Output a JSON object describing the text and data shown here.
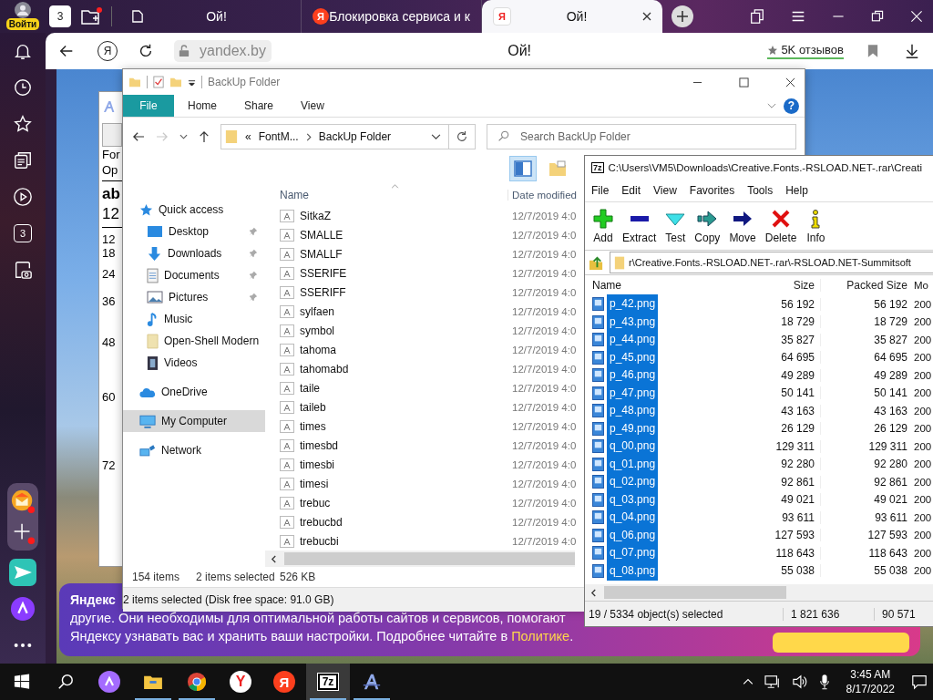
{
  "browser": {
    "account": {
      "label": "Войти"
    },
    "tab_counter": "3",
    "new_collection_badge": true,
    "tabs": [
      {
        "title": "Ой!",
        "kind": "page",
        "selected": false
      },
      {
        "title": "Блокировка сервиса и к",
        "kind": "red",
        "glyph": "Я",
        "selected": false
      },
      {
        "title": "Ой!",
        "kind": "light",
        "glyph": "Я",
        "selected": true
      }
    ],
    "address": {
      "logo": "Я",
      "url": "yandex.by",
      "page_title": "Ой!",
      "reviews": "5K отзывов"
    },
    "sidebar": [
      {
        "kind": "bell"
      },
      {
        "kind": "clock"
      },
      {
        "kind": "star"
      },
      {
        "kind": "collections"
      },
      {
        "kind": "play"
      },
      {
        "kind": "counter",
        "label": "3"
      },
      {
        "kind": "screenshot"
      }
    ],
    "apps": [
      {
        "kind": "mail",
        "badge": true
      },
      {
        "kind": "add",
        "badge": true
      },
      {
        "kind": "send",
        "badge": false
      },
      {
        "kind": "alice",
        "badge": false
      },
      {
        "kind": "more",
        "badge": false
      }
    ],
    "cookie_banner": {
      "title": "Яндекс",
      "line": "другие. Они необходимы для оптимальной работы сайтов и сервисов, помогают",
      "text": "Яндексу узнавать вас и хранить ваши настройки. Подробнее читайте в ",
      "link": "Политике",
      "end": "."
    }
  },
  "font_window": {
    "lines": [
      "For",
      "Op"
    ],
    "sample": "ab",
    "sample_size": "12",
    "sizes": [
      "12",
      "18",
      "24",
      "36",
      "48",
      "60",
      "72"
    ]
  },
  "explorer": {
    "title": "BackUp Folder",
    "ribbon_tabs": [
      {
        "label": "File",
        "selected": true
      },
      {
        "label": "Home",
        "selected": false
      },
      {
        "label": "Share",
        "selected": false
      },
      {
        "label": "View",
        "selected": false
      }
    ],
    "help": "?",
    "forward_disabled": true,
    "breadcrumb": {
      "overflow": "«",
      "parent": "FontM...",
      "current": "BackUp Folder"
    },
    "search": {
      "placeholder": "Search BackUp Folder"
    },
    "view_buttons": [
      {
        "kind": "pane",
        "selected": true
      },
      {
        "kind": "folder",
        "selected": false
      }
    ],
    "nav": [
      {
        "label": "Quick access",
        "kind": "star",
        "selected": false,
        "children": [
          {
            "label": "Desktop",
            "kind": "desktop",
            "pinned": true,
            "selected": false
          },
          {
            "label": "Downloads",
            "kind": "download",
            "pinned": true,
            "selected": false
          },
          {
            "label": "Documents",
            "kind": "documents",
            "pinned": true,
            "selected": false
          },
          {
            "label": "Pictures",
            "kind": "pictures",
            "pinned": true,
            "selected": false
          },
          {
            "label": "Music",
            "kind": "music",
            "pinned": false,
            "selected": false
          },
          {
            "label": "Open-Shell Modern",
            "kind": "folder",
            "pinned": false,
            "selected": false
          },
          {
            "label": "Videos",
            "kind": "video",
            "pinned": false,
            "selected": false
          }
        ]
      },
      {
        "label": "OneDrive",
        "kind": "cloud",
        "selected": false
      },
      {
        "label": "My Computer",
        "kind": "computer",
        "selected": true
      },
      {
        "label": "Network",
        "kind": "network",
        "selected": false
      }
    ],
    "columns": [
      "Name",
      "Date modified"
    ],
    "files": [
      {
        "name": "SitkaZ",
        "date": "12/7/2019 4:0"
      },
      {
        "name": "SMALLE",
        "date": "12/7/2019 4:0"
      },
      {
        "name": "SMALLF",
        "date": "12/7/2019 4:0"
      },
      {
        "name": "SSERIFE",
        "date": "12/7/2019 4:0"
      },
      {
        "name": "SSERIFF",
        "date": "12/7/2019 4:0"
      },
      {
        "name": "sylfaen",
        "date": "12/7/2019 4:0"
      },
      {
        "name": "symbol",
        "date": "12/7/2019 4:0"
      },
      {
        "name": "tahoma",
        "date": "12/7/2019 4:0"
      },
      {
        "name": "tahomabd",
        "date": "12/7/2019 4:0"
      },
      {
        "name": "taile",
        "date": "12/7/2019 4:0"
      },
      {
        "name": "taileb",
        "date": "12/7/2019 4:0"
      },
      {
        "name": "times",
        "date": "12/7/2019 4:0"
      },
      {
        "name": "timesbd",
        "date": "12/7/2019 4:0"
      },
      {
        "name": "timesbi",
        "date": "12/7/2019 4:0"
      },
      {
        "name": "timesi",
        "date": "12/7/2019 4:0"
      },
      {
        "name": "trebuc",
        "date": "12/7/2019 4:0"
      },
      {
        "name": "trebucbd",
        "date": "12/7/2019 4:0"
      },
      {
        "name": "trebucbi",
        "date": "12/7/2019 4:0"
      }
    ],
    "status": {
      "count": "154 items",
      "selection": "2 items selected",
      "size": "526 KB"
    },
    "info_bar": "2 items selected (Disk free space: 91.0 GB)"
  },
  "archive": {
    "title": "C:\\Users\\VM5\\Downloads\\Creative.Fonts.-RSLOAD.NET-.rar\\Creati",
    "icon_label": "7z",
    "menu": [
      "File",
      "Edit",
      "View",
      "Favorites",
      "Tools",
      "Help"
    ],
    "tools": [
      {
        "label": "Add",
        "kind": "add"
      },
      {
        "label": "Extract",
        "kind": "extract"
      },
      {
        "label": "Test",
        "kind": "test"
      },
      {
        "label": "Copy",
        "kind": "copy"
      },
      {
        "label": "Move",
        "kind": "move"
      },
      {
        "label": "Delete",
        "kind": "delete"
      },
      {
        "label": "Info",
        "kind": "info"
      }
    ],
    "path": "r\\Creative.Fonts.-RSLOAD.NET-.rar\\-RSLOAD.NET-Summitsoft",
    "columns": [
      "Name",
      "Size",
      "Packed Size",
      "Mo"
    ],
    "rows": [
      {
        "name": "p_42.png",
        "size": "56 192",
        "packed": "56 192",
        "column_4": "200",
        "selected": true
      },
      {
        "name": "p_43.png",
        "size": "18 729",
        "packed": "18 729",
        "column_4": "200",
        "selected": true
      },
      {
        "name": "p_44.png",
        "size": "35 827",
        "packed": "35 827",
        "column_4": "200",
        "selected": true
      },
      {
        "name": "p_45.png",
        "size": "64 695",
        "packed": "64 695",
        "column_4": "200",
        "selected": true
      },
      {
        "name": "p_46.png",
        "size": "49 289",
        "packed": "49 289",
        "column_4": "200",
        "selected": true
      },
      {
        "name": "p_47.png",
        "size": "50 141",
        "packed": "50 141",
        "column_4": "200",
        "selected": true
      },
      {
        "name": "p_48.png",
        "size": "43 163",
        "packed": "43 163",
        "column_4": "200",
        "selected": true
      },
      {
        "name": "p_49.png",
        "size": "26 129",
        "packed": "26 129",
        "column_4": "200",
        "selected": true
      },
      {
        "name": "q_00.png",
        "size": "129 311",
        "packed": "129 311",
        "column_4": "200",
        "selected": true
      },
      {
        "name": "q_01.png",
        "size": "92 280",
        "packed": "92 280",
        "column_4": "200",
        "selected": true
      },
      {
        "name": "q_02.png",
        "size": "92 861",
        "packed": "92 861",
        "column_4": "200",
        "selected": true
      },
      {
        "name": "q_03.png",
        "size": "49 021",
        "packed": "49 021",
        "column_4": "200",
        "selected": true
      },
      {
        "name": "q_04.png",
        "size": "93 611",
        "packed": "93 611",
        "column_4": "200",
        "selected": true
      },
      {
        "name": "q_06.png",
        "size": "127 593",
        "packed": "127 593",
        "column_4": "200",
        "selected": true
      },
      {
        "name": "q_07.png",
        "size": "118 643",
        "packed": "118 643",
        "column_4": "200",
        "selected": true
      },
      {
        "name": "q_08.png",
        "size": "55 038",
        "packed": "55 038",
        "column_4": "200",
        "selected": true
      }
    ],
    "status": {
      "selection": "19 / 5334 object(s) selected",
      "size": "1 821 636",
      "packed": "90 571"
    }
  },
  "taskbar": {
    "items": [
      {
        "kind": "start",
        "active": false,
        "running": false
      },
      {
        "kind": "search",
        "active": false,
        "running": false
      },
      {
        "kind": "alice",
        "active": false,
        "running": false
      },
      {
        "kind": "folder",
        "active": false,
        "running": true
      },
      {
        "kind": "chrome",
        "active": false,
        "running": true
      },
      {
        "kind": "yandex",
        "label": "Y",
        "active": false,
        "running": false
      },
      {
        "kind": "ya",
        "label": "Я",
        "active": false,
        "running": false
      },
      {
        "kind": "sevenzip",
        "label": "7z",
        "active": true,
        "running": true
      },
      {
        "kind": "fontview",
        "active": false,
        "running": true
      }
    ],
    "clock": {
      "time": "3:45 AM",
      "date": "8/17/2022"
    }
  }
}
